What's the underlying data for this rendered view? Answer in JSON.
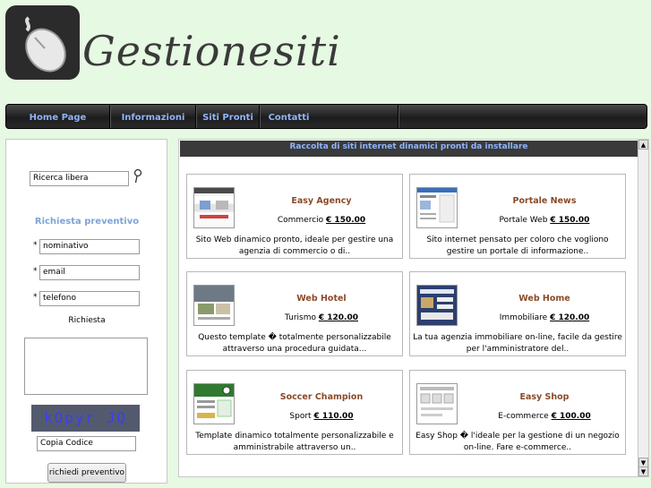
{
  "header": {
    "brand": "Gestionesiti"
  },
  "nav": [
    "Home Page",
    "Informazioni",
    "Siti Pronti",
    "Contatti"
  ],
  "sidebar": {
    "search_value": "Ricerca libera",
    "preventivo_title": "Richiesta preventivo",
    "name_value": "nominativo",
    "email_value": "email",
    "phone_value": "telefono",
    "required_mark": "*",
    "richiesta_label": "Richiesta",
    "captcha_text": "kOpyr JQ",
    "code_value": "Copia Codice",
    "submit_label": "richiedi preventivo"
  },
  "main": {
    "bar_title": "Raccolta di siti internet dinamici pronti da installare",
    "cards": [
      {
        "title": "Easy Agency",
        "category": "Commercio",
        "price": "€ 150.00",
        "desc": "Sito Web dinamico pronto, ideale per gestire una agenzia di commercio o di..",
        "thumb": "easy-agency-thumbnail"
      },
      {
        "title": "Portale News",
        "category": "Portale Web",
        "price": "€ 150.00",
        "desc": "Sito internet pensato per coloro che vogliono gestire un portale di informazione..",
        "thumb": "portale-news-thumbnail"
      },
      {
        "title": "Web Hotel",
        "category": "Turismo",
        "price": "€ 120.00",
        "desc": "Questo template � totalmente personalizzabile attraverso una procedura guidata...",
        "thumb": "web-hotel-thumbnail"
      },
      {
        "title": "Web Home",
        "category": "Immobiliare",
        "price": "€ 120.00",
        "desc": "La tua agenzia immobiliare on-line, facile da gestire per l'amministratore del..",
        "thumb": "web-home-thumbnail"
      },
      {
        "title": "Soccer Champion",
        "category": "Sport",
        "price": "€ 110.00",
        "desc": "Template dinamico totalmente personalizzabile e amministrabile attraverso un..",
        "thumb": "soccer-champion-thumbnail"
      },
      {
        "title": "Easy Shop",
        "category": "E-commerce",
        "price": "€ 100.00",
        "desc": "Easy Shop � l'ideale per la gestione di un negozio on-line. Fare e-commerce..",
        "thumb": "easy-shop-thumbnail"
      }
    ]
  },
  "colors": {
    "page_bg": "#e6f9e2",
    "nav_text": "#8fb4ff",
    "card_title": "#8a4b2a",
    "sidebar_title": "#7fa3d8"
  }
}
